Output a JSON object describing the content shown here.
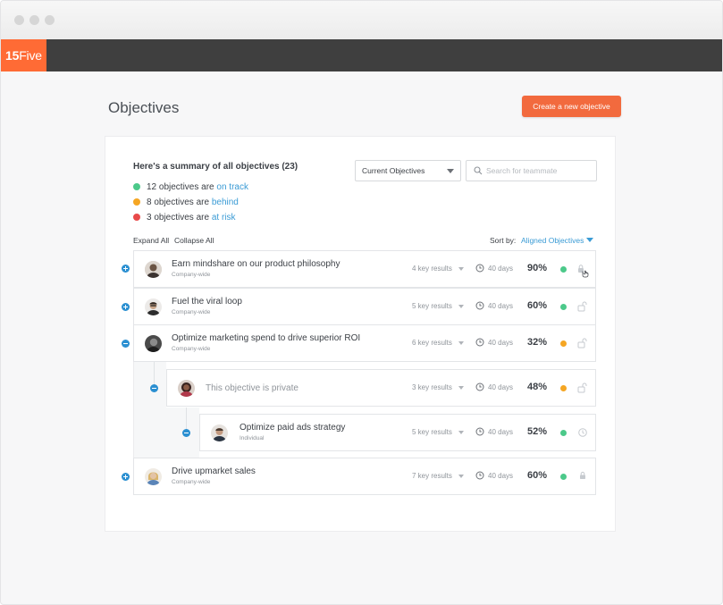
{
  "app": {
    "logo_num": "15",
    "logo_word": "Five"
  },
  "page": {
    "title": "Objectives",
    "create_button": "Create a new objective"
  },
  "summary": {
    "title": "Here's a summary of all objectives (23)",
    "lines": [
      {
        "prefix": "12 objectives are ",
        "link": "on track",
        "color": "#4cc98a"
      },
      {
        "prefix": "8 objectives are ",
        "link": "behind",
        "color": "#f5a623"
      },
      {
        "prefix": "3 objectives are ",
        "link": "at risk",
        "color": "#e84a4a"
      }
    ]
  },
  "filters": {
    "select_value": "Current Objectives",
    "search_placeholder": "Search for teammate"
  },
  "toolbar": {
    "expand_all": "Expand All",
    "collapse_all": "Collapse All",
    "sort_label": "Sort by:",
    "sort_value": "Aligned Objectives"
  },
  "colors": {
    "accent": "#f26a3e",
    "link": "#3a9bd5",
    "on_track": "#4cc98a",
    "behind": "#f5a623",
    "at_risk": "#e84a4a"
  },
  "objectives": [
    {
      "title": "Earn mindshare on our product philosophy",
      "scope": "Company-wide",
      "key_results": "4 key results",
      "days": "40 days",
      "percent": "90%",
      "status": "on-track",
      "trail_icon": "lock-icon"
    },
    {
      "title": "Fuel the viral loop",
      "scope": "Company-wide",
      "key_results": "5 key results",
      "days": "40 days",
      "percent": "60%",
      "status": "on-track",
      "trail_icon": "unlock-icon"
    },
    {
      "title": "Optimize marketing spend to drive superior ROI",
      "scope": "Company-wide",
      "key_results": "6 key results",
      "days": "40 days",
      "percent": "32%",
      "status": "behind",
      "trail_icon": "unlock-icon"
    },
    {
      "title": "This objective is private",
      "scope": "",
      "key_results": "3 key results",
      "days": "40 days",
      "percent": "48%",
      "status": "behind",
      "trail_icon": "unlock-icon"
    },
    {
      "title": "Optimize paid ads strategy",
      "scope": "Individual",
      "key_results": "5 key results",
      "days": "40 days",
      "percent": "52%",
      "status": "on-track",
      "trail_icon": "history-icon"
    },
    {
      "title": "Drive upmarket sales",
      "scope": "Company-wide",
      "key_results": "7 key results",
      "days": "40 days",
      "percent": "60%",
      "status": "on-track",
      "trail_icon": "lock-icon"
    }
  ]
}
